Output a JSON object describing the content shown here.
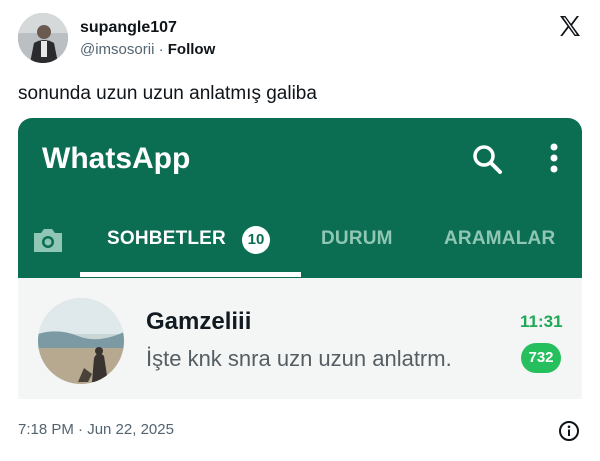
{
  "author": {
    "name": "supangle107",
    "handle": "@imsosorii",
    "separator": " · ",
    "follow_label": "Follow"
  },
  "tweet": {
    "text": "sonunda uzun uzun anlatmış galiba",
    "timestamp": "7:18 PM · Jun 22, 2025"
  },
  "whatsapp": {
    "app_title": "WhatsApp",
    "tabs": [
      {
        "label": "SOHBETLER",
        "badge": "10",
        "active": true
      },
      {
        "label": "DURUM"
      },
      {
        "label": "ARAMALAR"
      }
    ],
    "chat": {
      "name": "Gamzeliii",
      "message": "İşte knk snra uzn uzun anlatrm.",
      "time": "11:31",
      "unread": "732"
    },
    "colors": {
      "header": "#0b6e52",
      "accent_green": "#25c05d",
      "inactive_tab": "#8fc7b4"
    }
  },
  "icons": {
    "x_logo": "x-logo-icon",
    "search": "search-icon",
    "more": "more-vert-icon",
    "camera": "camera-icon",
    "info": "info-icon"
  }
}
